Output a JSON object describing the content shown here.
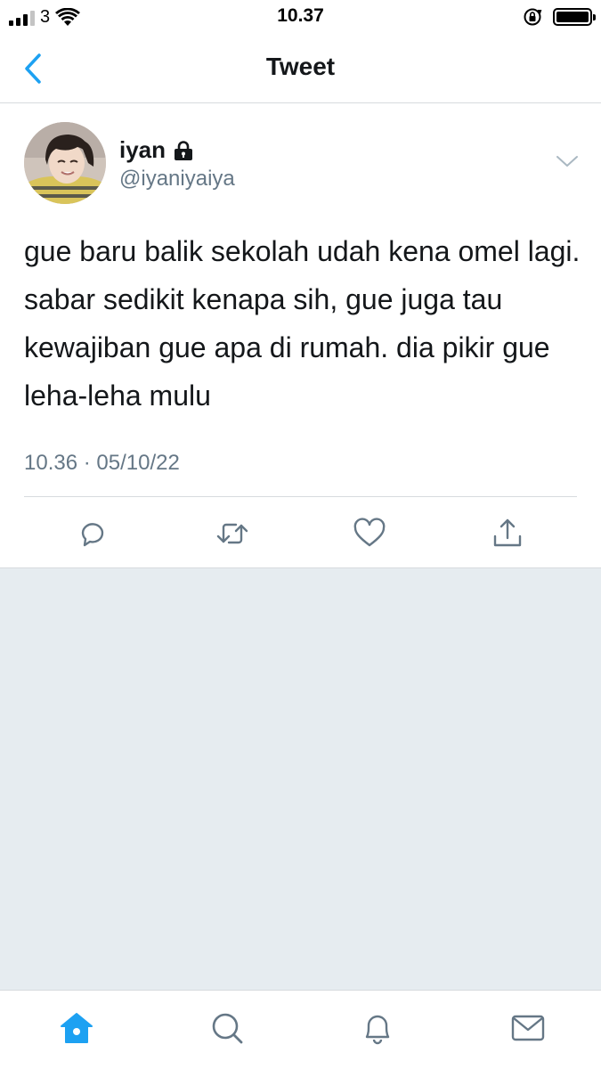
{
  "status_bar": {
    "carrier": "3",
    "time": "10.37"
  },
  "header": {
    "title": "Tweet"
  },
  "tweet": {
    "display_name": "iyan",
    "handle": "@iyaniyaiya",
    "text": "gue baru balik sekolah udah kena omel lagi. sabar sedikit kenapa sih, gue juga tau kewajiban gue apa di rumah. dia pikir gue leha-leha mulu",
    "timestamp": "10.36 · 05/10/22"
  },
  "icons": {
    "back": "chevron-left-icon",
    "lock": "lock-icon",
    "more": "chevron-down-icon",
    "reply": "reply-icon",
    "retweet": "retweet-icon",
    "like": "heart-icon",
    "share": "share-icon",
    "home": "home-icon",
    "search": "search-icon",
    "notifications": "bell-icon",
    "messages": "mail-icon"
  },
  "colors": {
    "accent": "#1da1f2",
    "icon_gray": "#657786",
    "background_gray": "#e6ecf0"
  }
}
